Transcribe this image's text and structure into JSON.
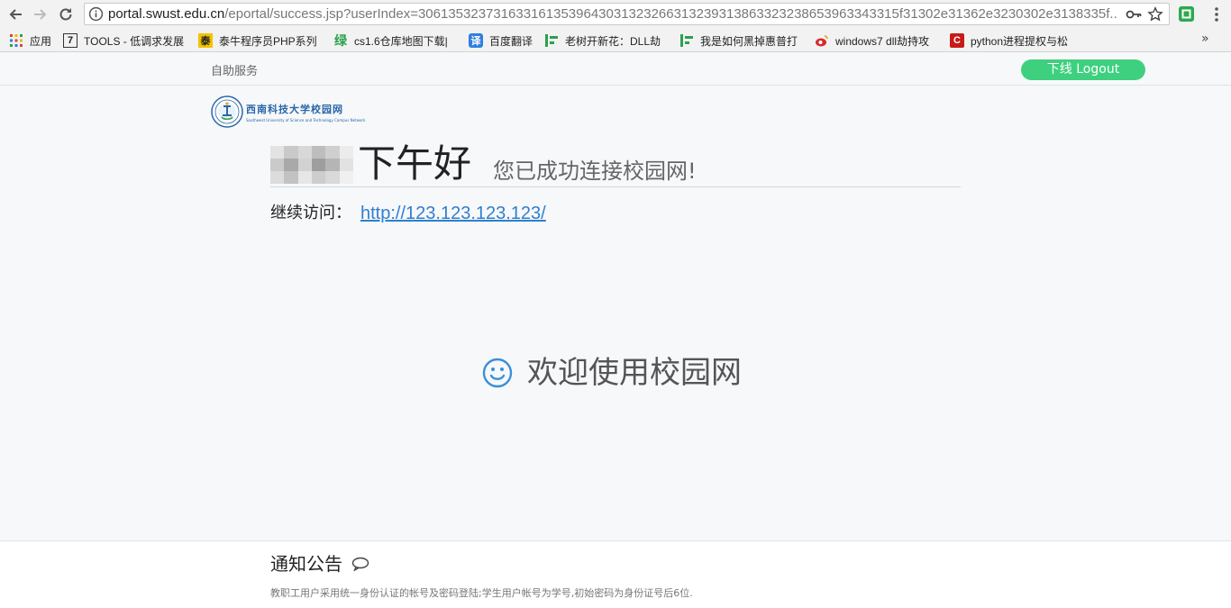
{
  "browser": {
    "url_host": "portal.swust.edu.cn",
    "url_path": "/eportal/success.jsp?userIndex=3061353237316331613539643031323266313239313863323238653963343315f31302e31362e3230302e3138335f..."
  },
  "bookmarks": {
    "items": [
      {
        "label": "应用",
        "icon": "apps-grid-icon"
      },
      {
        "label": "TOOLS - 低调求发展",
        "icon": "tools-icon"
      },
      {
        "label": "泰牛程序员PHP系列",
        "icon": "taiNiu-icon"
      },
      {
        "label": "cs1.6仓库地图下载|",
        "icon": "lv-icon"
      },
      {
        "label": "百度翻译",
        "icon": "translate-icon"
      },
      {
        "label": "老树开新花：DLL劫",
        "icon": "article-icon"
      },
      {
        "label": "我是如何黑掉惠普打",
        "icon": "article-icon"
      },
      {
        "label": "windows7 dll劫持攻",
        "icon": "weibo-icon"
      },
      {
        "label": "python进程提权与松",
        "icon": "c-icon"
      }
    ],
    "more": "»"
  },
  "portal": {
    "self_service": "自助服务",
    "logout": "下线 Logout",
    "logo_cn": "西南科技大学校园网",
    "logo_en": "Southwest University of Science and Technology Campus Network",
    "greeting": "下午好",
    "success": "您已成功连接校园网!",
    "continue_label": "继续访问：",
    "continue_link": "http://123.123.123.123/",
    "welcome": "欢迎使用校园网"
  },
  "notice": {
    "title": "通知公告",
    "body": "教职工用户采用统一身份认证的帐号及密码登陆;学生用户帐号为学号,初始密码为身份证号后6位."
  },
  "colors": {
    "accent": "#3ed07f",
    "link": "#2f7fce",
    "brand": "#2a67a8"
  }
}
